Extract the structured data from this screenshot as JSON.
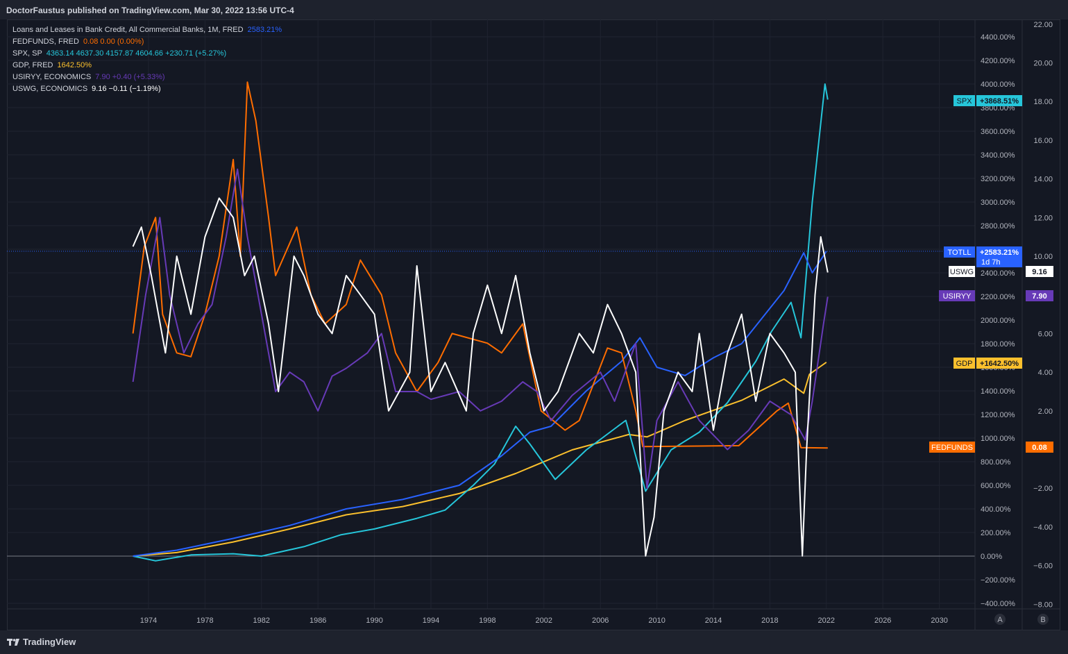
{
  "header": {
    "publisher": "DoctorFaustus published on TradingView.com, Mar 30, 2022 13:56 UTC-4"
  },
  "footer": {
    "brand": "TradingView"
  },
  "legend": [
    {
      "name": "Loans and Leases in Bank Credit, All Commercial Banks, 1M, FRED",
      "values": "2583.21%",
      "color": "#2962ff"
    },
    {
      "name": "FEDFUNDS, FRED",
      "values": "0.08  0.00 (0.00%)",
      "color": "#ff6d00"
    },
    {
      "name": "SPX, SP",
      "values": "4363.14  4637.30  4157.87  4604.66  +230.71 (+5.27%)",
      "color": "#26c6da"
    },
    {
      "name": "GDP, FRED",
      "values": "1642.50%",
      "color": "#fbc02d"
    },
    {
      "name": "USIRYY, ECONOMICS",
      "values": "7.90  +0.40 (+5.33%)",
      "color": "#673ab7"
    },
    {
      "name": "USWG, ECONOMICS",
      "values": "9.16  −0.11 (−1.19%)",
      "color": "#ffffff"
    }
  ],
  "axis_tags": {
    "spx": {
      "name": "SPX",
      "value": "+3868.51%",
      "color": "#26c6da"
    },
    "totll": {
      "name": "TOTLL",
      "value": "+2583.21%",
      "extra": "1d 7h",
      "color": "#2962ff"
    },
    "uswg": {
      "name": "USWG",
      "value": "9.16",
      "color": "#ffffff"
    },
    "usiryy": {
      "name": "USIRYY",
      "value": "7.90",
      "color": "#673ab7"
    },
    "gdp": {
      "name": "GDP",
      "value": "+1642.50%",
      "color": "#fbc02d"
    },
    "fedfunds": {
      "name": "FEDFUNDS",
      "value": "0.08",
      "color": "#ff6d00"
    }
  },
  "scale_buttons": [
    "A",
    "B"
  ],
  "chart_data": {
    "type": "line",
    "x_ticks": [
      "1974",
      "1978",
      "1982",
      "1986",
      "1990",
      "1994",
      "1998",
      "2002",
      "2006",
      "2010",
      "2014",
      "2018",
      "2022",
      "2026",
      "2030"
    ],
    "left_axis_ticks": [
      "4400.00%",
      "4200.00%",
      "4000.00%",
      "3800.00%",
      "3600.00%",
      "3400.00%",
      "3200.00%",
      "3000.00%",
      "2800.00%",
      "2600.00%",
      "2400.00%",
      "2200.00%",
      "2000.00%",
      "1800.00%",
      "1600.00%",
      "1400.00%",
      "1200.00%",
      "1000.00%",
      "800.00%",
      "600.00%",
      "400.00%",
      "200.00%",
      "0.00%",
      "−200.00%",
      "−400.00%"
    ],
    "right_axis_ticks": [
      "22.00",
      "20.00",
      "18.00",
      "16.00",
      "14.00",
      "12.00",
      "10.00",
      "8.00",
      "6.00",
      "4.00",
      "2.00",
      "−2.00",
      "−4.00",
      "−6.00",
      "−8.00"
    ],
    "pct_range": [
      -450,
      4550
    ],
    "rate_range": [
      -8.4,
      22.2
    ],
    "series": [
      {
        "name": "TOTLL",
        "axis": "pct",
        "color": "#2962ff",
        "points": [
          [
            1972.9,
            0
          ],
          [
            1976,
            50
          ],
          [
            1980,
            150
          ],
          [
            1984,
            260
          ],
          [
            1988,
            400
          ],
          [
            1992,
            480
          ],
          [
            1996,
            600
          ],
          [
            1999,
            850
          ],
          [
            2001,
            1050
          ],
          [
            2002.5,
            1100
          ],
          [
            2005,
            1400
          ],
          [
            2007.5,
            1650
          ],
          [
            2008.8,
            1850
          ],
          [
            2010,
            1600
          ],
          [
            2012,
            1530
          ],
          [
            2014,
            1680
          ],
          [
            2016,
            1800
          ],
          [
            2017,
            1950
          ],
          [
            2019,
            2250
          ],
          [
            2020.4,
            2570
          ],
          [
            2021,
            2400
          ],
          [
            2022,
            2583
          ]
        ]
      },
      {
        "name": "GDP",
        "axis": "pct",
        "color": "#fbc02d",
        "points": [
          [
            1972.9,
            0
          ],
          [
            1976,
            30
          ],
          [
            1980,
            120
          ],
          [
            1984,
            230
          ],
          [
            1988,
            350
          ],
          [
            1992,
            420
          ],
          [
            1996,
            530
          ],
          [
            2000,
            700
          ],
          [
            2004,
            900
          ],
          [
            2008,
            1030
          ],
          [
            2009.3,
            1010
          ],
          [
            2012,
            1150
          ],
          [
            2016,
            1320
          ],
          [
            2019,
            1500
          ],
          [
            2020.4,
            1380
          ],
          [
            2020.8,
            1540
          ],
          [
            2021.5,
            1600
          ],
          [
            2022,
            1642.5
          ]
        ]
      },
      {
        "name": "SPX",
        "axis": "pct",
        "color": "#26c6da",
        "points": [
          [
            1972.9,
            0
          ],
          [
            1974.5,
            -40
          ],
          [
            1977,
            10
          ],
          [
            1980,
            20
          ],
          [
            1982,
            0
          ],
          [
            1985,
            80
          ],
          [
            1987.6,
            180
          ],
          [
            1990,
            230
          ],
          [
            1993,
            320
          ],
          [
            1995,
            390
          ],
          [
            1997,
            600
          ],
          [
            1998.5,
            780
          ],
          [
            2000,
            1100
          ],
          [
            2001,
            950
          ],
          [
            2002.8,
            650
          ],
          [
            2005,
            900
          ],
          [
            2007.8,
            1150
          ],
          [
            2009.2,
            550
          ],
          [
            2011,
            900
          ],
          [
            2013,
            1050
          ],
          [
            2015,
            1300
          ],
          [
            2017,
            1650
          ],
          [
            2018.1,
            1900
          ],
          [
            2019.5,
            2150
          ],
          [
            2020.2,
            1850
          ],
          [
            2021,
            3000
          ],
          [
            2021.9,
            4000
          ],
          [
            2022.1,
            3868.51
          ]
        ]
      },
      {
        "name": "FEDFUNDS",
        "axis": "rate",
        "color": "#ff6d00",
        "points": [
          [
            1972.9,
            6
          ],
          [
            1973.7,
            10.5
          ],
          [
            1974.5,
            12
          ],
          [
            1975,
            7
          ],
          [
            1976,
            5
          ],
          [
            1977,
            4.8
          ],
          [
            1978,
            7
          ],
          [
            1979,
            10
          ],
          [
            1980,
            15
          ],
          [
            1980.5,
            10
          ],
          [
            1981,
            19
          ],
          [
            1981.6,
            17
          ],
          [
            1982.5,
            12
          ],
          [
            1983,
            9
          ],
          [
            1984.5,
            11.5
          ],
          [
            1985.5,
            8
          ],
          [
            1986.5,
            6.5
          ],
          [
            1988,
            7.5
          ],
          [
            1989,
            9.8
          ],
          [
            1990.5,
            8
          ],
          [
            1991.5,
            5
          ],
          [
            1993,
            3
          ],
          [
            1994.5,
            4.5
          ],
          [
            1995.5,
            6
          ],
          [
            1998,
            5.5
          ],
          [
            1999,
            5
          ],
          [
            2000.5,
            6.5
          ],
          [
            2001.8,
            2
          ],
          [
            2003.5,
            1
          ],
          [
            2004.5,
            1.5
          ],
          [
            2006.5,
            5.25
          ],
          [
            2007.5,
            5
          ],
          [
            2008.5,
            2
          ],
          [
            2009,
            0.15
          ],
          [
            2015.8,
            0.2
          ],
          [
            2017,
            1
          ],
          [
            2018.5,
            2
          ],
          [
            2019.3,
            2.4
          ],
          [
            2020.2,
            0.1
          ],
          [
            2022.1,
            0.08
          ]
        ]
      },
      {
        "name": "USIRYY",
        "axis": "rate",
        "color": "#673ab7",
        "points": [
          [
            1972.9,
            3.5
          ],
          [
            1973.8,
            8
          ],
          [
            1974.8,
            12
          ],
          [
            1975.5,
            8
          ],
          [
            1976.5,
            5
          ],
          [
            1977.5,
            6.5
          ],
          [
            1978.5,
            7.5
          ],
          [
            1979.5,
            11
          ],
          [
            1980.3,
            14.5
          ],
          [
            1981,
            11
          ],
          [
            1982,
            7
          ],
          [
            1983,
            3
          ],
          [
            1984,
            4
          ],
          [
            1985,
            3.5
          ],
          [
            1986,
            2
          ],
          [
            1987,
            3.8
          ],
          [
            1988,
            4.2
          ],
          [
            1989.5,
            5
          ],
          [
            1990.5,
            6
          ],
          [
            1991.5,
            3
          ],
          [
            1993,
            3
          ],
          [
            1994,
            2.6
          ],
          [
            1996,
            3
          ],
          [
            1997.5,
            2
          ],
          [
            1999,
            2.5
          ],
          [
            2000.5,
            3.5
          ],
          [
            2001.5,
            3
          ],
          [
            2002.5,
            1.5
          ],
          [
            2004,
            2.8
          ],
          [
            2006,
            4
          ],
          [
            2007,
            2.5
          ],
          [
            2008.5,
            5.5
          ],
          [
            2009.3,
            -2
          ],
          [
            2010,
            1.5
          ],
          [
            2011.5,
            3.5
          ],
          [
            2013,
            1.5
          ],
          [
            2015,
            0
          ],
          [
            2016.5,
            1
          ],
          [
            2018,
            2.5
          ],
          [
            2019.5,
            1.8
          ],
          [
            2020.5,
            0.5
          ],
          [
            2021,
            2.5
          ],
          [
            2021.8,
            6.5
          ],
          [
            2022.1,
            7.9
          ]
        ]
      },
      {
        "name": "USWG",
        "axis": "rate",
        "color": "#ffffff",
        "points": [
          [
            1972.9,
            10.5
          ],
          [
            1973.5,
            11.5
          ],
          [
            1974.2,
            9
          ],
          [
            1975.2,
            5
          ],
          [
            1976,
            10
          ],
          [
            1977,
            7
          ],
          [
            1978,
            11
          ],
          [
            1979,
            13
          ],
          [
            1980,
            12
          ],
          [
            1980.8,
            9
          ],
          [
            1981.5,
            10
          ],
          [
            1982.5,
            6.5
          ],
          [
            1983.2,
            3
          ],
          [
            1984.3,
            10
          ],
          [
            1985,
            9
          ],
          [
            1986,
            7
          ],
          [
            1987,
            6
          ],
          [
            1988,
            9
          ],
          [
            1989,
            8
          ],
          [
            1990,
            7
          ],
          [
            1991,
            2
          ],
          [
            1992.5,
            4
          ],
          [
            1993,
            9.5
          ],
          [
            1994,
            3
          ],
          [
            1995,
            4.5
          ],
          [
            1996.5,
            2
          ],
          [
            1997,
            6
          ],
          [
            1998,
            8.5
          ],
          [
            1999,
            6
          ],
          [
            2000,
            9
          ],
          [
            2001,
            5
          ],
          [
            2002,
            2
          ],
          [
            2003,
            3
          ],
          [
            2004.5,
            6
          ],
          [
            2005.5,
            5
          ],
          [
            2006.5,
            7.5
          ],
          [
            2007.5,
            6
          ],
          [
            2008.5,
            4
          ],
          [
            2009.2,
            -5.5
          ],
          [
            2009.8,
            -3.5
          ],
          [
            2010.5,
            2
          ],
          [
            2011.5,
            4
          ],
          [
            2012.5,
            3
          ],
          [
            2013,
            6
          ],
          [
            2014,
            1
          ],
          [
            2015,
            5
          ],
          [
            2016,
            7
          ],
          [
            2017,
            2.5
          ],
          [
            2018,
            6
          ],
          [
            2019,
            5
          ],
          [
            2019.8,
            4
          ],
          [
            2020.3,
            -5.5
          ],
          [
            2020.6,
            0
          ],
          [
            2021.2,
            8
          ],
          [
            2021.6,
            11
          ],
          [
            2022.1,
            9.16
          ]
        ]
      }
    ]
  }
}
